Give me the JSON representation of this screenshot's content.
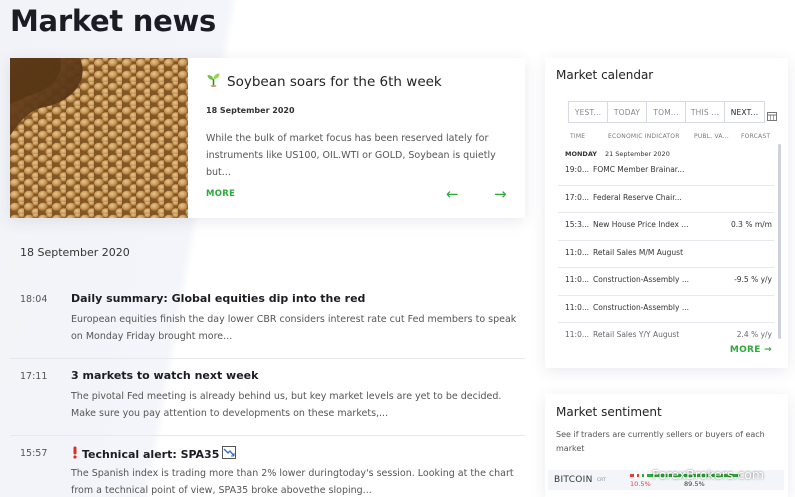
{
  "page": {
    "title": "Market news"
  },
  "featured": {
    "title": "Soybean soars for the 6th week",
    "date": "18 September 2020",
    "description": "While the bulk of market focus has been reserved lately for instruments like US100, OIL.WTI or GOLD, Soybean is quietly but...",
    "more_label": "MORE",
    "prev_icon": "arrow-left-icon",
    "next_icon": "arrow-right-icon",
    "accent": "#2eaa3a"
  },
  "news": {
    "date_heading": "18 September 2020",
    "items": [
      {
        "time": "18:04",
        "title": "Daily summary: Global equities dip into the red",
        "text": "European equities finish the day lower CBR considers interest rate cut Fed members to speak on Monday Friday brought more..."
      },
      {
        "time": "17:11",
        "title": "3 markets to watch next week",
        "text": "The pivotal Fed meeting is already behind us, but key market levels are yet to be decided. Make sure you pay attention to developments on these markets,..."
      },
      {
        "time": "15:57",
        "title": "Technical alert: SPA35",
        "text": "The Spanish index is trading more than 2% lower duringtoday's session. Looking at the chart from a technical point of view, SPA35 broke abovethe sloping..."
      }
    ]
  },
  "calendar": {
    "title": "Market calendar",
    "tabs": [
      "YEST...",
      "TODAY",
      "TOM...",
      "THIS ...",
      "NEXT..."
    ],
    "active_tab": "NEXT...",
    "headers": {
      "time": "TIME",
      "indicator": "ECONOMIC INDICATOR",
      "previous": "PUBL. VA...",
      "forecast": "FORCAST"
    },
    "day_label": "MONDAY",
    "day_date": "21 September 2020",
    "rows": [
      {
        "time": "19:0...",
        "event": "FOMC Member Brainar...",
        "forecast": ""
      },
      {
        "time": "17:0...",
        "event": "Federal Reserve Chair...",
        "forecast": ""
      },
      {
        "time": "15:3...",
        "event": "New House Price Index ...",
        "forecast": "0.3 % m/m"
      },
      {
        "time": "11:0...",
        "event": "Retail Sales M/M August",
        "forecast": ""
      },
      {
        "time": "11:0...",
        "event": "Construction-Assembly ...",
        "forecast": "-9.5 % y/y"
      },
      {
        "time": "11:0...",
        "event": "Construction-Assembly ...",
        "forecast": ""
      },
      {
        "time": "11:0...",
        "event": "Retail Sales Y/Y August",
        "forecast": "2.4 % y/y"
      }
    ],
    "more_label": "MORE →"
  },
  "sentiment": {
    "title": "Market sentiment",
    "description": "See if traders are currently sellers or buyers of each market",
    "row": {
      "symbol": "BITCOIN",
      "category": "CRT",
      "sell": "10.5%",
      "buy": "89.5%",
      "sell_fraction": 0.105
    },
    "sell_color": "#e04040",
    "buy_color": "#2eaa3a"
  },
  "watermark": {
    "text": "ForexBrokers.com"
  }
}
